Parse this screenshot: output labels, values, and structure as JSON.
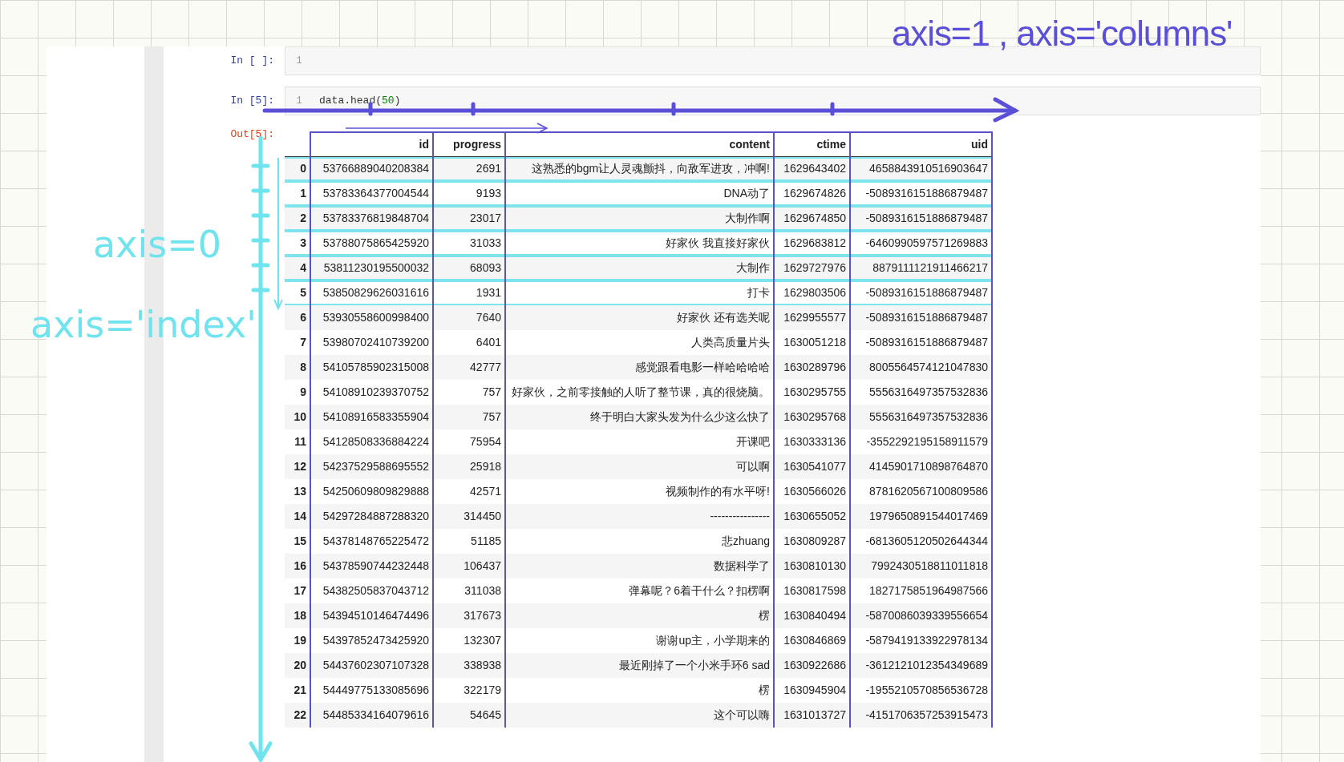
{
  "notebook": {
    "cells": [
      {
        "prompt": "In [ ]:",
        "line_number": "1"
      },
      {
        "prompt": "In [5]:",
        "line_number": "1",
        "code": [
          {
            "text": "data.head(",
            "kind": "plain"
          },
          {
            "text": "50",
            "kind": "number"
          },
          {
            "text": ")",
            "kind": "plain"
          }
        ]
      }
    ],
    "output": {
      "prompt": "Out[5]:",
      "table": {
        "columns": [
          {
            "label": "id",
            "boxed": true
          },
          {
            "label": "progress",
            "boxed": true
          },
          {
            "label": "content",
            "boxed": true
          },
          {
            "label": "ctime",
            "boxed": true
          },
          {
            "label": "uid",
            "boxed": true
          }
        ],
        "rows": [
          {
            "index": "0",
            "highlighted": true,
            "cells": [
              "53766889040208384",
              "2691",
              "这熟悉的bgm让人灵魂颤抖，向敌军进攻，冲啊!",
              "1629643402",
              "4658843910516903647"
            ]
          },
          {
            "index": "1",
            "highlighted": true,
            "cells": [
              "53783364377004544",
              "9193",
              "DNA动了",
              "1629674826",
              "-5089316151886879487"
            ]
          },
          {
            "index": "2",
            "highlighted": true,
            "cells": [
              "53783376819848704",
              "23017",
              "大制作啊",
              "1629674850",
              "-5089316151886879487"
            ]
          },
          {
            "index": "3",
            "highlighted": true,
            "cells": [
              "53788075865425920",
              "31033",
              "好家伙 我直接好家伙",
              "1629683812",
              "-6460990597571269883"
            ]
          },
          {
            "index": "4",
            "highlighted": true,
            "cells": [
              "53811230195500032",
              "68093",
              "大制作",
              "1629727976",
              "8879111121911466217"
            ]
          },
          {
            "index": "5",
            "highlighted": true,
            "cells": [
              "53850829626031616",
              "1931",
              "打卡",
              "1629803506",
              "-5089316151886879487"
            ]
          },
          {
            "index": "6",
            "highlighted": false,
            "cells": [
              "53930558600998400",
              "7640",
              "好家伙 还有选关呢",
              "1629955577",
              "-5089316151886879487"
            ]
          },
          {
            "index": "7",
            "highlighted": false,
            "cells": [
              "53980702410739200",
              "6401",
              "人类高质量片头",
              "1630051218",
              "-5089316151886879487"
            ]
          },
          {
            "index": "8",
            "highlighted": false,
            "cells": [
              "54105785902315008",
              "42777",
              "感觉跟看电影一样哈哈哈哈",
              "1630289796",
              "8005564574121047830"
            ]
          },
          {
            "index": "9",
            "highlighted": false,
            "cells": [
              "54108910239370752",
              "757",
              "好家伙，之前零接触的人听了整节课，真的很烧脑。",
              "1630295755",
              "5556316497357532836"
            ]
          },
          {
            "index": "10",
            "highlighted": false,
            "cells": [
              "54108916583355904",
              "757",
              "终于明白大家头发为什么少这么快了",
              "1630295768",
              "5556316497357532836"
            ]
          },
          {
            "index": "11",
            "highlighted": false,
            "cells": [
              "54128508336884224",
              "75954",
              "开课吧",
              "1630333136",
              "-3552292195158911579"
            ]
          },
          {
            "index": "12",
            "highlighted": false,
            "cells": [
              "54237529588695552",
              "25918",
              "可以啊",
              "1630541077",
              "4145901710898764870"
            ]
          },
          {
            "index": "13",
            "highlighted": false,
            "cells": [
              "54250609809829888",
              "42571",
              "视频制作的有水平呀!",
              "1630566026",
              "8781620567100809586"
            ]
          },
          {
            "index": "14",
            "highlighted": false,
            "cells": [
              "54297284887288320",
              "314450",
              "----------------",
              "1630655052",
              "1979650891544017469"
            ]
          },
          {
            "index": "15",
            "highlighted": false,
            "cells": [
              "54378148765225472",
              "51185",
              "悲zhuang",
              "1630809287",
              "-6813605120502644344"
            ]
          },
          {
            "index": "16",
            "highlighted": false,
            "cells": [
              "54378590744232448",
              "106437",
              "数据科学了",
              "1630810130",
              "7992430518811011818"
            ]
          },
          {
            "index": "17",
            "highlighted": false,
            "cells": [
              "54382505837043712",
              "311038",
              "弹幕呢？6着干什么？扣楞啊",
              "1630817598",
              "1827175851964987566"
            ]
          },
          {
            "index": "18",
            "highlighted": false,
            "cells": [
              "54394510146474496",
              "317673",
              "楞",
              "1630840494",
              "-5870086039339556654"
            ]
          },
          {
            "index": "19",
            "highlighted": false,
            "cells": [
              "54397852473425920",
              "132307",
              "谢谢up主，小学期来的",
              "1630846869",
              "-5879419133922978134"
            ]
          },
          {
            "index": "20",
            "highlighted": false,
            "cells": [
              "54437602307107328",
              "338938",
              "最近刚掉了一个小米手环6 sad",
              "1630922686",
              "-3612121012354349689"
            ]
          },
          {
            "index": "21",
            "highlighted": false,
            "cells": [
              "54449775133085696",
              "322179",
              "楞",
              "1630945904",
              "-1955210570856536728"
            ]
          },
          {
            "index": "22",
            "highlighted": false,
            "cells": [
              "54485334164079616",
              "54645",
              "这个可以嗨",
              "1631013727",
              "-4151706357253915473"
            ]
          }
        ]
      }
    }
  },
  "annotations": [
    {
      "text": "axis=1 , axis='columns'",
      "color": "#5a4fd8"
    },
    {
      "text": "axis=0",
      "color": "#6fe3ee"
    },
    {
      "text": "axis='index'",
      "color": "#6fe3ee"
    }
  ]
}
